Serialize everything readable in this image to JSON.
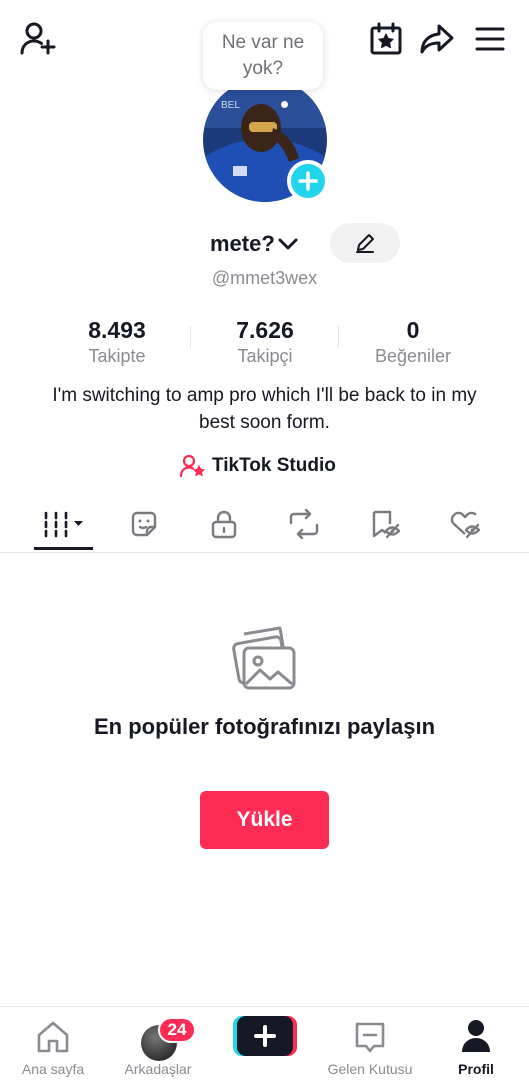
{
  "note": {
    "text": "Ne var ne yok?"
  },
  "profile": {
    "display_name": "mete?",
    "handle": "@mmet3wex",
    "bio": "I'm switching to amp pro which I'll be back to in my best soon form."
  },
  "stats": {
    "following": {
      "value": "8.493",
      "label": "Takipte"
    },
    "followers": {
      "value": "7.626",
      "label": "Takipçi"
    },
    "likes": {
      "value": "0",
      "label": "Beğeniler"
    }
  },
  "studio": {
    "label": "TikTok Studio"
  },
  "tabs": [
    {
      "icon": "videos-grid-icon",
      "active": true
    },
    {
      "icon": "sticker-icon"
    },
    {
      "icon": "lock-icon"
    },
    {
      "icon": "repost-icon"
    },
    {
      "icon": "favorites-hidden-icon"
    },
    {
      "icon": "liked-hidden-icon"
    }
  ],
  "empty_state": {
    "title": "En popüler fotoğrafınızı paylaşın",
    "button": "Yükle"
  },
  "bottom_nav": {
    "home": "Ana sayfa",
    "friends": "Arkadaşlar",
    "friends_badge": "24",
    "inbox": "Gelen Kutusu",
    "profile": "Profil"
  },
  "colors": {
    "accent": "#fe2c55",
    "cyan": "#20d5ec",
    "text": "#161823",
    "muted": "#8a8b91"
  }
}
